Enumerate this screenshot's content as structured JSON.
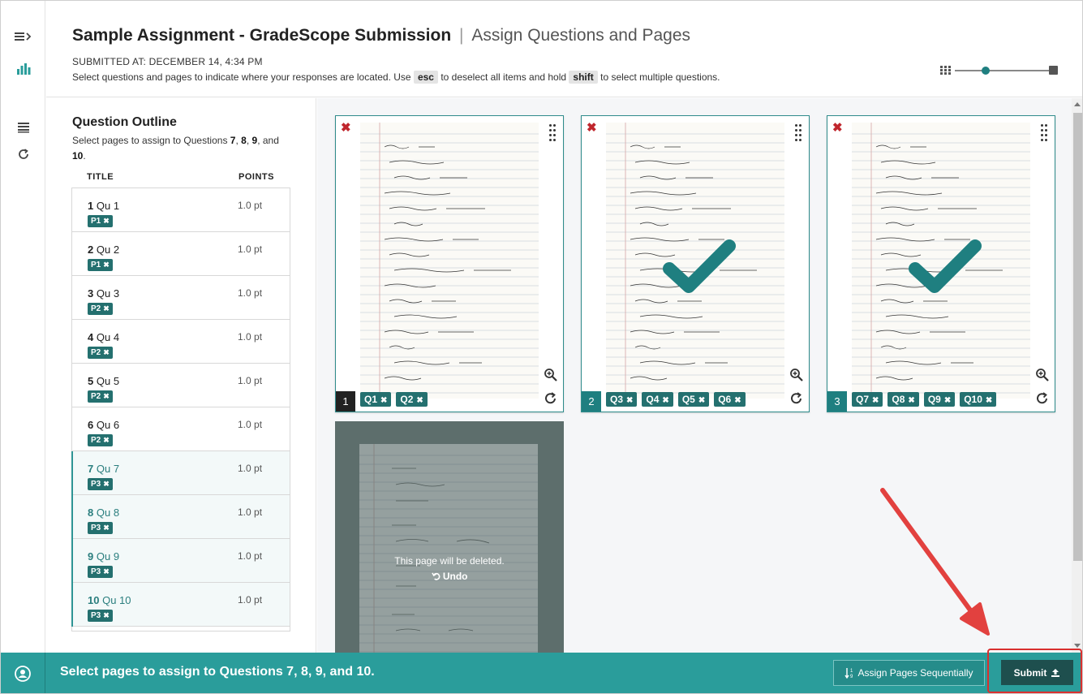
{
  "header": {
    "assignment_title": "Sample Assignment - GradeScope Submission",
    "separator": "|",
    "subtitle": "Assign Questions and Pages",
    "submitted_label": "SUBMITTED AT: DECEMBER 14, 4:34 PM",
    "instructions": {
      "part1": "Select questions and pages to indicate where your responses are located. Use",
      "key1": "esc",
      "part2": "to deselect all items and hold",
      "key2": "shift",
      "part3": "to select multiple questions."
    },
    "zoom_level": 0.33
  },
  "outline": {
    "title": "Question Outline",
    "desc_prefix": "Select pages to assign to Questions ",
    "desc_q1": "7",
    "desc_q2": "8",
    "desc_q3": "9",
    "desc_and": ", and",
    "desc_q4": "10",
    "col_title": "TITLE",
    "col_points": "POINTS",
    "questions": [
      {
        "num": "1",
        "name": "Qu 1",
        "points": "1.0 pt",
        "tag": "P1",
        "selected": false
      },
      {
        "num": "2",
        "name": "Qu 2",
        "points": "1.0 pt",
        "tag": "P1",
        "selected": false
      },
      {
        "num": "3",
        "name": "Qu 3",
        "points": "1.0 pt",
        "tag": "P2",
        "selected": false
      },
      {
        "num": "4",
        "name": "Qu 4",
        "points": "1.0 pt",
        "tag": "P2",
        "selected": false
      },
      {
        "num": "5",
        "name": "Qu 5",
        "points": "1.0 pt",
        "tag": "P2",
        "selected": false
      },
      {
        "num": "6",
        "name": "Qu 6",
        "points": "1.0 pt",
        "tag": "P2",
        "selected": false
      },
      {
        "num": "7",
        "name": "Qu 7",
        "points": "1.0 pt",
        "tag": "P3",
        "selected": true
      },
      {
        "num": "8",
        "name": "Qu 8",
        "points": "1.0 pt",
        "tag": "P3",
        "selected": true
      },
      {
        "num": "9",
        "name": "Qu 9",
        "points": "1.0 pt",
        "tag": "P3",
        "selected": true
      },
      {
        "num": "10",
        "name": "Qu 10",
        "points": "1.0 pt",
        "tag": "P3",
        "selected": true
      }
    ]
  },
  "pages": [
    {
      "number": "1",
      "tags": [
        "Q1",
        "Q2"
      ],
      "checked": false
    },
    {
      "number": "2",
      "tags": [
        "Q3",
        "Q4",
        "Q5",
        "Q6"
      ],
      "checked": true
    },
    {
      "number": "3",
      "tags": [
        "Q7",
        "Q8",
        "Q9",
        "Q10"
      ],
      "checked": true
    }
  ],
  "deleted_page": {
    "message": "This page will be deleted.",
    "undo_label": "Undo"
  },
  "footer": {
    "message": "Select pages to assign to Questions 7, 8, 9, and 10.",
    "assign_sequentially_label": "Assign Pages Sequentially",
    "submit_label": "Submit"
  },
  "colors": {
    "teal": "#2a9d9b",
    "dark_teal": "#24706f",
    "delete_red": "#c0262d",
    "annotation_red": "#e2413f"
  },
  "icons": {
    "rail": [
      "menu-expand-icon",
      "bar-chart-icon",
      "list-icon",
      "refresh-icon"
    ],
    "card": [
      "delete-x-icon",
      "drag-handle-icon",
      "zoom-in-icon",
      "rotate-icon",
      "check-icon"
    ],
    "footer": [
      "person-icon",
      "sort-numeric-icon",
      "upload-icon"
    ]
  }
}
